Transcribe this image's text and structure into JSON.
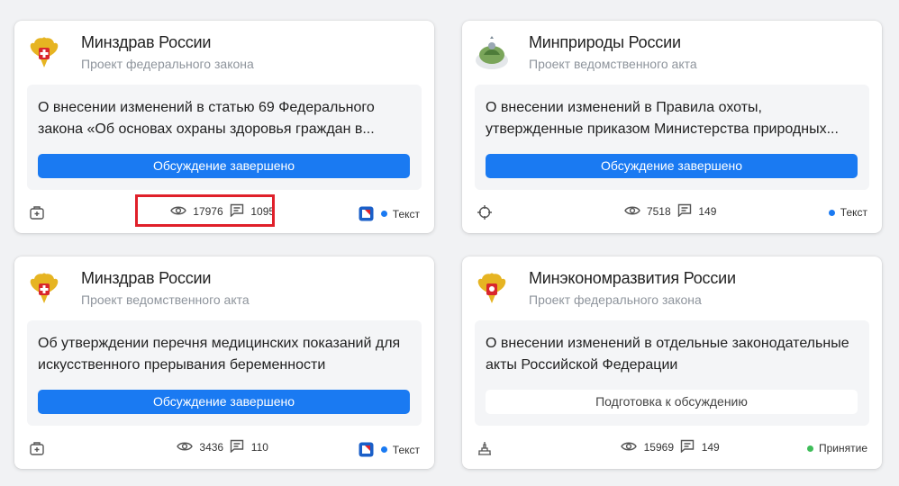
{
  "colors": {
    "accent": "#1a7af2",
    "text_tag_dot": "#1a7af2",
    "adoption_dot": "#3ebd59",
    "highlight": "#e0202a"
  },
  "cards": [
    {
      "ministry": "Минздрав России",
      "doctype": "Проект федерального закона",
      "description": "О внесении изменений в статью 69 Федерального закона «Об основах охраны здоровья граждан в...",
      "status": "Обсуждение завершено",
      "footer_icon": "medkit-icon",
      "views": "17976",
      "comments": "1095",
      "tag": "Текст",
      "gosuslugi": true
    },
    {
      "ministry": "Минприроды России",
      "doctype": "Проект ведомственного акта",
      "description": "О внесении изменений в Правила охоты, утвержденные приказом Министерства природных...",
      "status": "Обсуждение завершено",
      "footer_icon": "target-icon",
      "views": "7518",
      "comments": "149",
      "tag": "Текст",
      "gosuslugi": false
    },
    {
      "ministry": "Минздрав России",
      "doctype": "Проект ведомственного акта",
      "description": "Об утверждении перечня медицинских показаний для искусственного прерывания беременности",
      "status": "Обсуждение завершено",
      "footer_icon": "medkit-icon",
      "views": "3436",
      "comments": "110",
      "tag": "Текст",
      "gosuslugi": true
    },
    {
      "ministry": "Минэкономразвития России",
      "doctype": "Проект федерального закона",
      "description": "О внесении изменений в отдельные законодательные акты Российской Федерации",
      "status": "Подготовка к обсуждению",
      "footer_icon": "factory-icon",
      "views": "15969",
      "comments": "149",
      "tag": "Принятие",
      "gosuslugi": false
    }
  ]
}
